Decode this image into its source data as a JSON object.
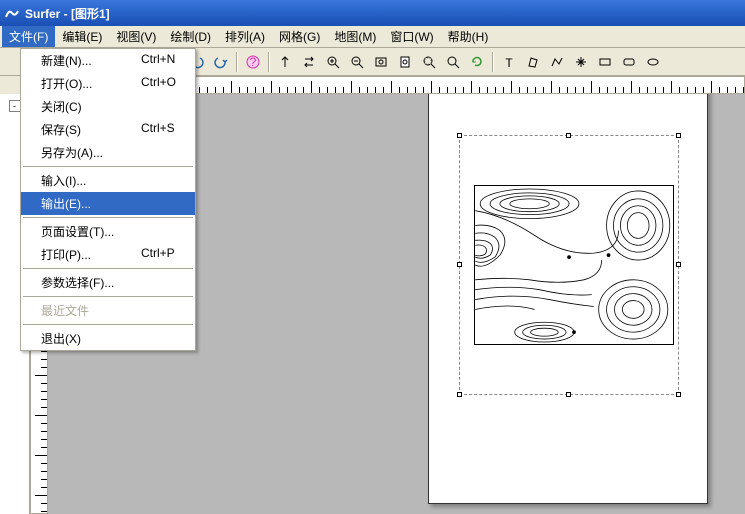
{
  "title": "Surfer - [图形1]",
  "menubar": {
    "items": [
      {
        "label": "文件(F)"
      },
      {
        "label": "编辑(E)"
      },
      {
        "label": "视图(V)"
      },
      {
        "label": "绘制(D)"
      },
      {
        "label": "排列(A)"
      },
      {
        "label": "网格(G)"
      },
      {
        "label": "地图(M)"
      },
      {
        "label": "窗口(W)"
      },
      {
        "label": "帮助(H)"
      }
    ]
  },
  "file_menu": {
    "new": {
      "label": "新建(N)...",
      "shortcut": "Ctrl+N"
    },
    "open": {
      "label": "打开(O)...",
      "shortcut": "Ctrl+O"
    },
    "close": {
      "label": "关闭(C)",
      "shortcut": ""
    },
    "save": {
      "label": "保存(S)",
      "shortcut": "Ctrl+S"
    },
    "saveas": {
      "label": "另存为(A)...",
      "shortcut": ""
    },
    "import": {
      "label": "输入(I)...",
      "shortcut": ""
    },
    "export": {
      "label": "输出(E)...",
      "shortcut": ""
    },
    "pagesetup": {
      "label": "页面设置(T)...",
      "shortcut": ""
    },
    "print": {
      "label": "打印(P)...",
      "shortcut": "Ctrl+P"
    },
    "prefs": {
      "label": "参数选择(F)...",
      "shortcut": ""
    },
    "recent": {
      "label": "最近文件",
      "shortcut": ""
    },
    "exit": {
      "label": "退出(X)",
      "shortcut": ""
    }
  }
}
